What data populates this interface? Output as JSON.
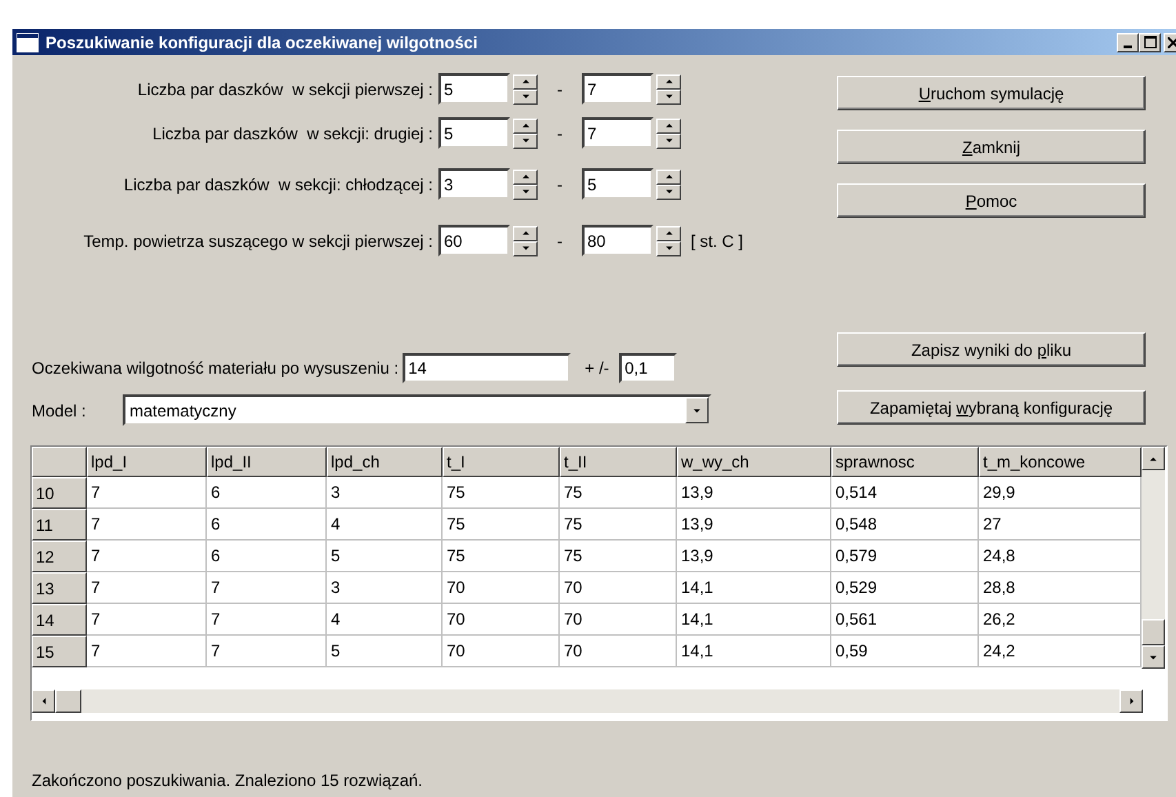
{
  "window": {
    "title": "Poszukiwanie konfiguracji dla oczekiwanej wilgotności"
  },
  "ranges": [
    {
      "label": "Liczba par daszków  w sekcji pierwszej :",
      "from": "5",
      "to": "7"
    },
    {
      "label": "Liczba par daszków  w sekcji: drugiej :",
      "from": "5",
      "to": "7"
    },
    {
      "label": "Liczba par daszków  w sekcji: chłodzącej :",
      "from": "3",
      "to": "5"
    },
    {
      "label": "Temp. powietrza suszącego w sekcji pierwszej :",
      "from": "60",
      "to": "80",
      "unit": "[ st. C ]"
    }
  ],
  "range_separator": "-",
  "top_buttons": [
    {
      "key": "U",
      "after": "ruchom symulację"
    },
    {
      "key": "Z",
      "after": "amknij"
    },
    {
      "key": "P",
      "after": "omoc"
    }
  ],
  "target": {
    "label": "Oczekiwana wilgotność materiału po wysuszeniu :",
    "value": "14",
    "tolerance_label": "+ /-",
    "tolerance": "0,1"
  },
  "model": {
    "label": "Model :",
    "value": "matematyczny"
  },
  "bottom_buttons": [
    {
      "before": "Zapisz wyniki do ",
      "key": "p",
      "after": "liku"
    },
    {
      "before": "Zapamiętaj ",
      "key": "w",
      "after": "ybraną konfigurację"
    }
  ],
  "table": {
    "columns": [
      "lpd_I",
      "lpd_II",
      "lpd_ch",
      "t_I",
      "t_II",
      "w_wy_ch",
      "sprawnosc",
      "t_m_koncowe"
    ],
    "rows": [
      {
        "number": "10",
        "cells": [
          "7",
          "6",
          "3",
          "75",
          "75",
          "13,9",
          "0,514",
          "29,9"
        ]
      },
      {
        "number": "11",
        "cells": [
          "7",
          "6",
          "4",
          "75",
          "75",
          "13,9",
          "0,548",
          "27"
        ]
      },
      {
        "number": "12",
        "cells": [
          "7",
          "6",
          "5",
          "75",
          "75",
          "13,9",
          "0,579",
          "24,8"
        ]
      },
      {
        "number": "13",
        "cells": [
          "7",
          "7",
          "3",
          "70",
          "70",
          "14,1",
          "0,529",
          "28,8"
        ]
      },
      {
        "number": "14",
        "cells": [
          "7",
          "7",
          "4",
          "70",
          "70",
          "14,1",
          "0,561",
          "26,2"
        ]
      },
      {
        "number": "15",
        "cells": [
          "7",
          "7",
          "5",
          "70",
          "70",
          "14,1",
          "0,59",
          "24,2"
        ]
      }
    ]
  },
  "status_bar": "Zakończono poszukiwania. Znaleziono 15 rozwiązań."
}
